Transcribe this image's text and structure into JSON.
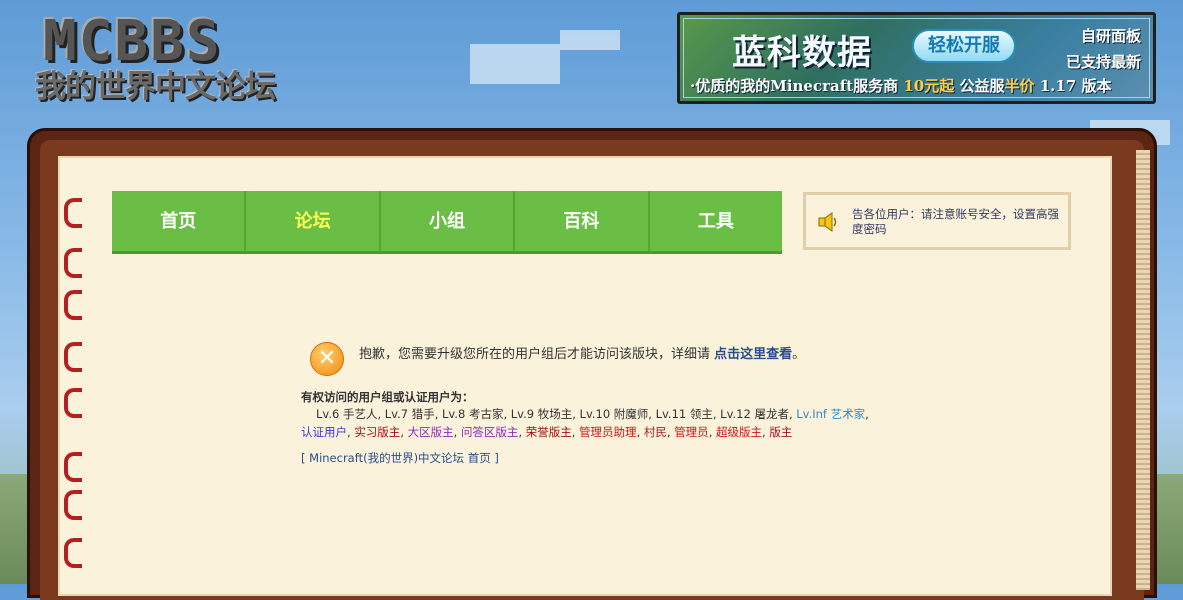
{
  "logo": {
    "main": "MCBBS",
    "sub": "我的世界中文论坛"
  },
  "banner": {
    "title": "蓝科数据",
    "button": "轻松开服",
    "side_1": "自研面板",
    "side_2": "已支持最新",
    "bottom_a": "·优质的我的Minecraft服务商 ",
    "bottom_b": "10元起",
    "bottom_c": " 公益服",
    "bottom_d": "半价",
    "bottom_e": " 1.17 版本"
  },
  "nav": [
    {
      "label": "首页"
    },
    {
      "label": "论坛"
    },
    {
      "label": "小组"
    },
    {
      "label": "百科"
    },
    {
      "label": "工具"
    }
  ],
  "notice": {
    "text": "告各位用户：请注意账号安全，设置高强度密码"
  },
  "message": {
    "text": "抱歉，您需要升级您所在的用户组后才能访问该版块，详细请 ",
    "link": "点击这里查看",
    "suffix": "。"
  },
  "groups": {
    "title": "有权访问的用户组或认证用户为：",
    "line1_plain": "Lv.6 手艺人, Lv.7 猎手, Lv.8 考古家, Lv.9 牧场主, Lv.10 附魔师, Lv.11 领主, Lv.12 屠龙者, ",
    "line1_inf": "Lv.Inf 艺术家",
    "line1_comma": ",",
    "g1": "认证用户",
    "g2": "实习版主",
    "g3": "大区版主",
    "g4": "问答区版主",
    "g5": "荣誉版主",
    "g6": "管理员助理",
    "g7": "村民",
    "g8": "管理员",
    "g9": "超级版主",
    "g10": "版主",
    "sep": ", "
  },
  "home_link": "[ Minecraft(我的世界)中文论坛 首页 ]"
}
